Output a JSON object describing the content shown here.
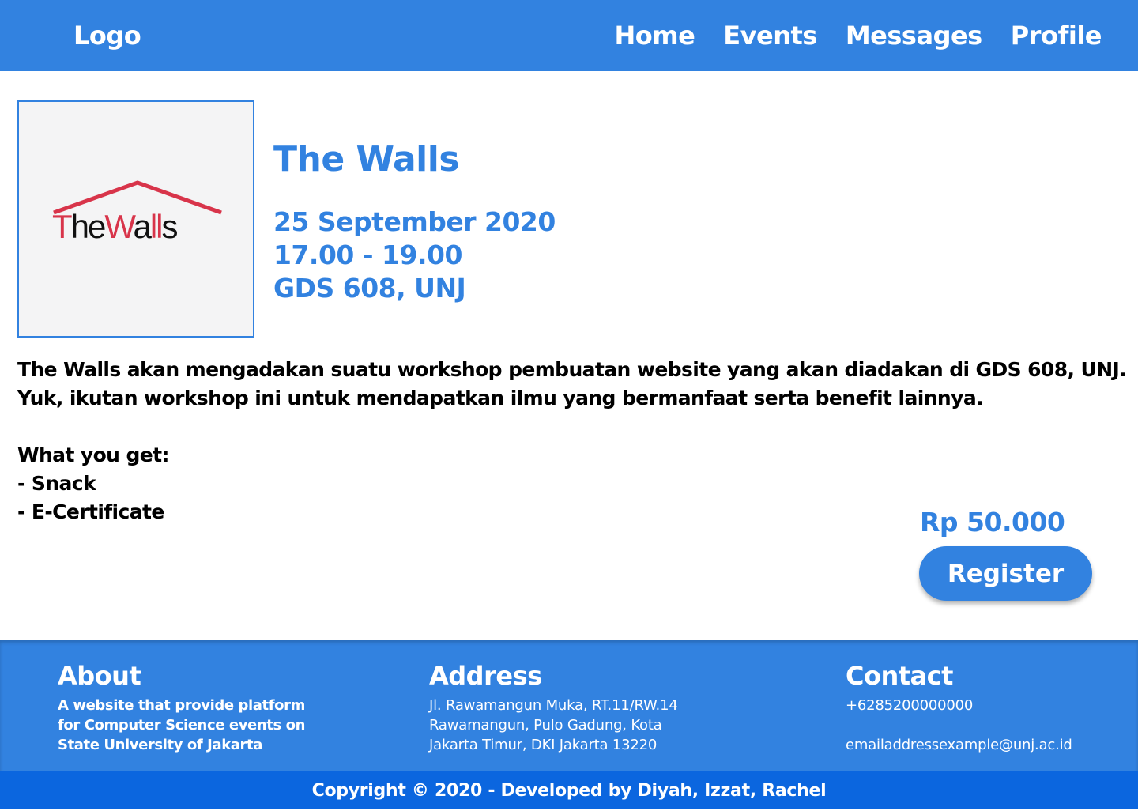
{
  "navbar": {
    "logo": "Logo",
    "links": [
      "Home",
      "Events",
      "Messages",
      "Profile"
    ]
  },
  "event": {
    "image_logo_text": "TheWalls",
    "title": "The Walls",
    "date": "25 September 2020",
    "time": "17.00 - 19.00",
    "location": "GDS 608, UNJ",
    "description": [
      "The Walls akan mengadakan suatu workshop pembuatan website yang akan diadakan di GDS 608, UNJ.",
      "Yuk, ikutan workshop ini untuk mendapatkan ilmu yang bermanfaat serta benefit lainnya."
    ],
    "benefits_heading": "What you get:",
    "benefits": [
      "- Snack",
      "- E-Certificate"
    ],
    "price": "Rp 50.000",
    "register_label": "Register"
  },
  "footer": {
    "about": {
      "title": "About",
      "lines": [
        "A website that provide platform",
        "for Computer Science events on",
        "State University of Jakarta"
      ]
    },
    "address": {
      "title": "Address",
      "lines": [
        "Jl. Rawamangun Muka, RT.11/RW.14",
        "Rawamangun, Pulo Gadung, Kota",
        "Jakarta Timur, DKI Jakarta 13220"
      ]
    },
    "contact": {
      "title": "Contact",
      "phone": "+6285200000000",
      "email": "emailaddressexample@unj.ac.id"
    },
    "copyright": "Copyright © 2020 - Developed by Diyah, Izzat, Rachel"
  },
  "colors": {
    "primary": "#3282e0",
    "copyright_bar": "#0b66df",
    "logo_red": "#d8344a"
  }
}
